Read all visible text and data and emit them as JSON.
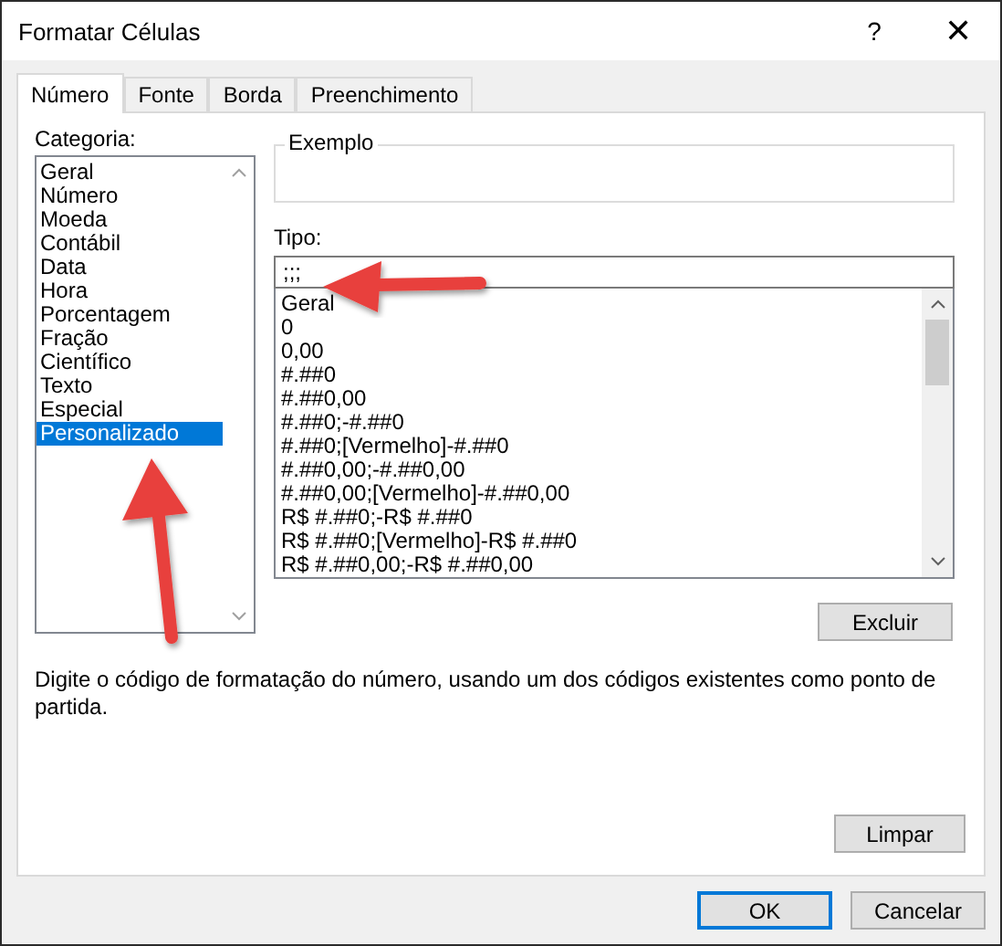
{
  "window": {
    "title": "Formatar Células",
    "help": "?",
    "close": "✕"
  },
  "tabs": [
    {
      "label": "Número",
      "selected": true
    },
    {
      "label": "Fonte",
      "selected": false
    },
    {
      "label": "Borda",
      "selected": false
    },
    {
      "label": "Preenchimento",
      "selected": false
    }
  ],
  "category": {
    "label": "Categoria:",
    "items": [
      {
        "label": "Geral",
        "selected": false
      },
      {
        "label": "Número",
        "selected": false
      },
      {
        "label": "Moeda",
        "selected": false
      },
      {
        "label": "Contábil",
        "selected": false
      },
      {
        "label": "Data",
        "selected": false
      },
      {
        "label": "Hora",
        "selected": false
      },
      {
        "label": "Porcentagem",
        "selected": false
      },
      {
        "label": "Fração",
        "selected": false
      },
      {
        "label": "Científico",
        "selected": false
      },
      {
        "label": "Texto",
        "selected": false
      },
      {
        "label": "Especial",
        "selected": false
      },
      {
        "label": "Personalizado",
        "selected": true
      }
    ]
  },
  "sample": {
    "label": "Exemplo"
  },
  "type": {
    "label": "Tipo:",
    "value": ";;;",
    "items": [
      "Geral",
      "0",
      "0,00",
      "#.##0",
      "#.##0,00",
      "#.##0;-#.##0",
      "#.##0;[Vermelho]-#.##0",
      "#.##0,00;-#.##0,00",
      "#.##0,00;[Vermelho]-#.##0,00",
      "R$ #.##0;-R$ #.##0",
      "R$ #.##0;[Vermelho]-R$ #.##0",
      "R$ #.##0,00;-R$ #.##0,00"
    ]
  },
  "delete_button": "Excluir",
  "description": "Digite o código de formatação do número, usando um dos códigos existentes como ponto de partida.",
  "clear_button": "Limpar",
  "buttons": [
    {
      "label": "OK",
      "default": true
    },
    {
      "label": "Cancelar",
      "default": false
    }
  ]
}
